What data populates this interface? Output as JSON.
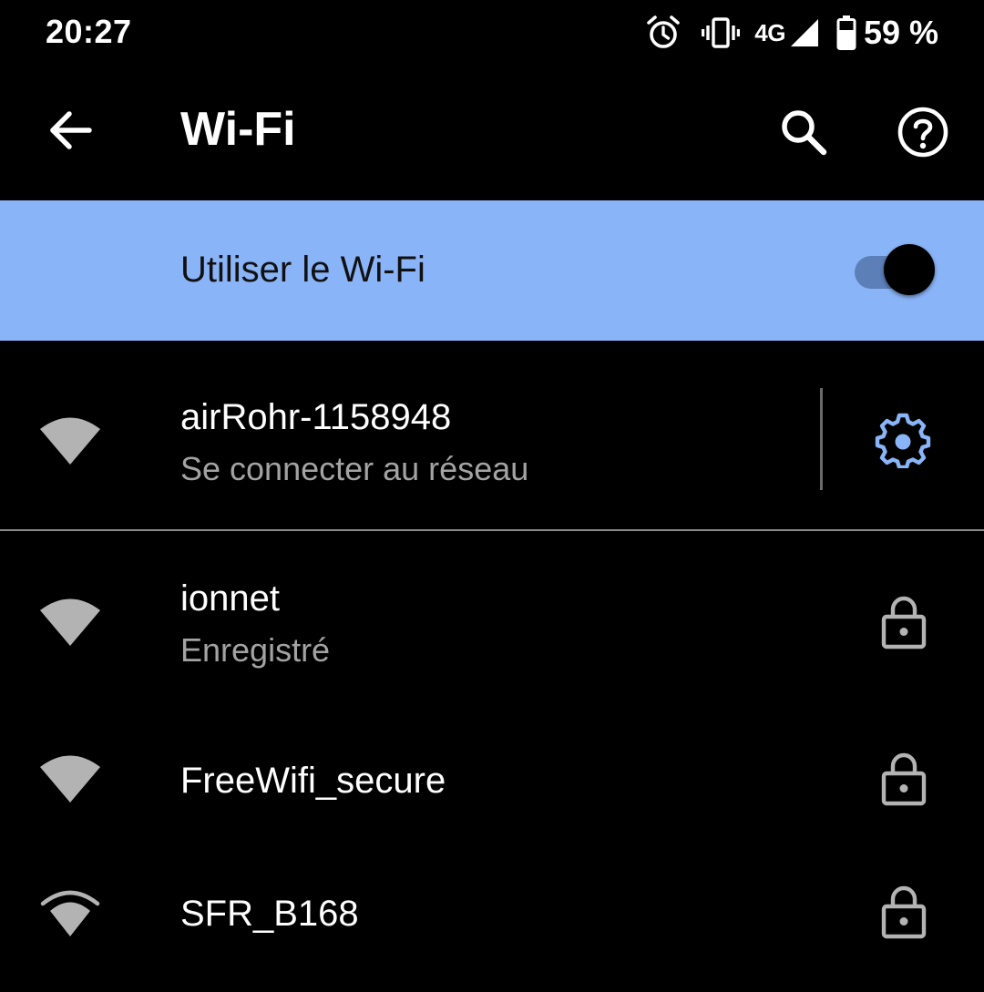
{
  "status_bar": {
    "time": "20:27",
    "icons": [
      "alarm-icon",
      "vibrate-icon",
      "cell-signal-icon",
      "battery-icon"
    ],
    "network": "4G",
    "battery": "59 %"
  },
  "app_bar": {
    "title": "Wi-Fi",
    "icons": [
      "back-arrow-icon",
      "search-icon",
      "help-icon"
    ]
  },
  "master_switch": {
    "label": "Utiliser le Wi-Fi",
    "enabled": true
  },
  "networks": [
    {
      "name": "airRohr-1158948",
      "status": "Se connecter au réseau",
      "secured": false,
      "action_icon": "gear-icon"
    },
    {
      "name": "ionnet",
      "status": "Enregistré",
      "secured": true
    },
    {
      "name": "FreeWifi_secure",
      "status": "",
      "secured": true
    },
    {
      "name": "SFR_B168",
      "status": "",
      "secured": true
    }
  ],
  "colors": {
    "background": "#000000",
    "accent": "#8ab4f8",
    "switch_track": "#5c7fb8",
    "secondary_text": "#a3a3a3",
    "icon_gray": "#b3b3b3"
  }
}
